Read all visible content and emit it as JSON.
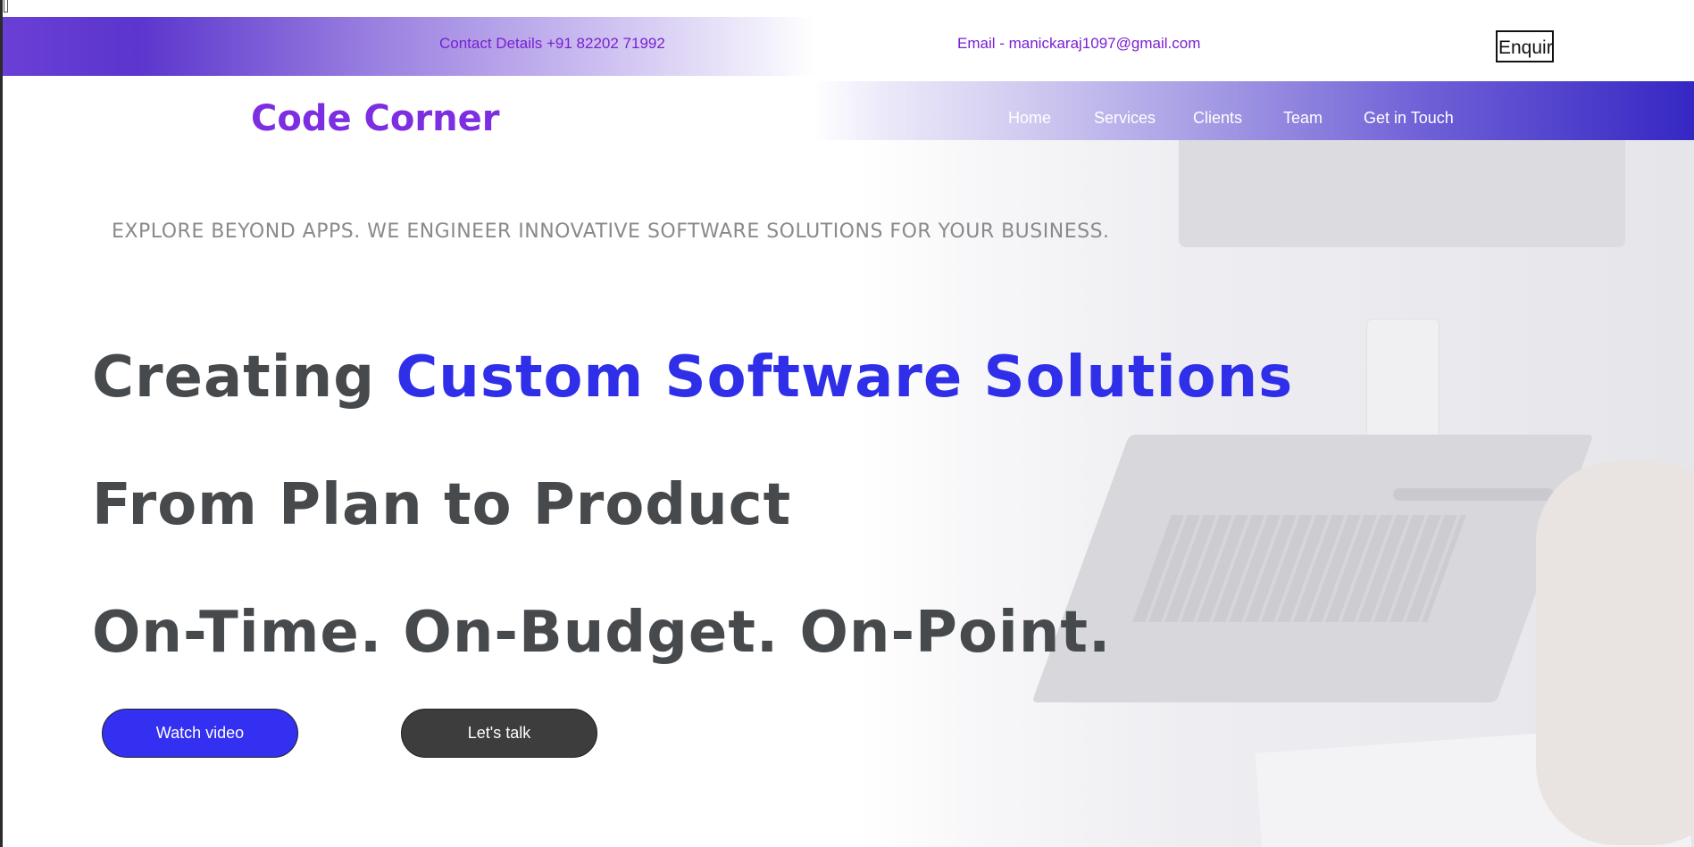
{
  "contact_bar": {
    "phone": "Contact Details +91 82202 71992",
    "email": "Email - manickaraj1097@gmail.com",
    "enquiry_button": "Enquiry"
  },
  "brand": {
    "name": "Code Corner"
  },
  "nav": {
    "items": [
      {
        "label": "Home"
      },
      {
        "label": "Services"
      },
      {
        "label": "Clients"
      },
      {
        "label": "Team"
      },
      {
        "label": "Get in Touch"
      }
    ]
  },
  "hero": {
    "tagline": "EXPLORE BEYOND APPS. WE ENGINEER INNOVATIVE SOFTWARE SOLUTIONS FOR YOUR BUSINESS.",
    "headline_1_prefix": "Creating ",
    "headline_1_accent": "Custom Software Solutions",
    "headline_2": "From Plan to Product",
    "headline_3": "On-Time. On-Budget. On-Point.",
    "watch_video": "Watch video",
    "lets_talk": "Let's talk"
  },
  "colors": {
    "brand": "#7c2ee0",
    "accent": "#2f2ee8",
    "headline": "#474a4d",
    "primary_button": "#3430f2",
    "secondary_button": "#3d3d3d",
    "nav_gradient_end": "#3527c3"
  }
}
